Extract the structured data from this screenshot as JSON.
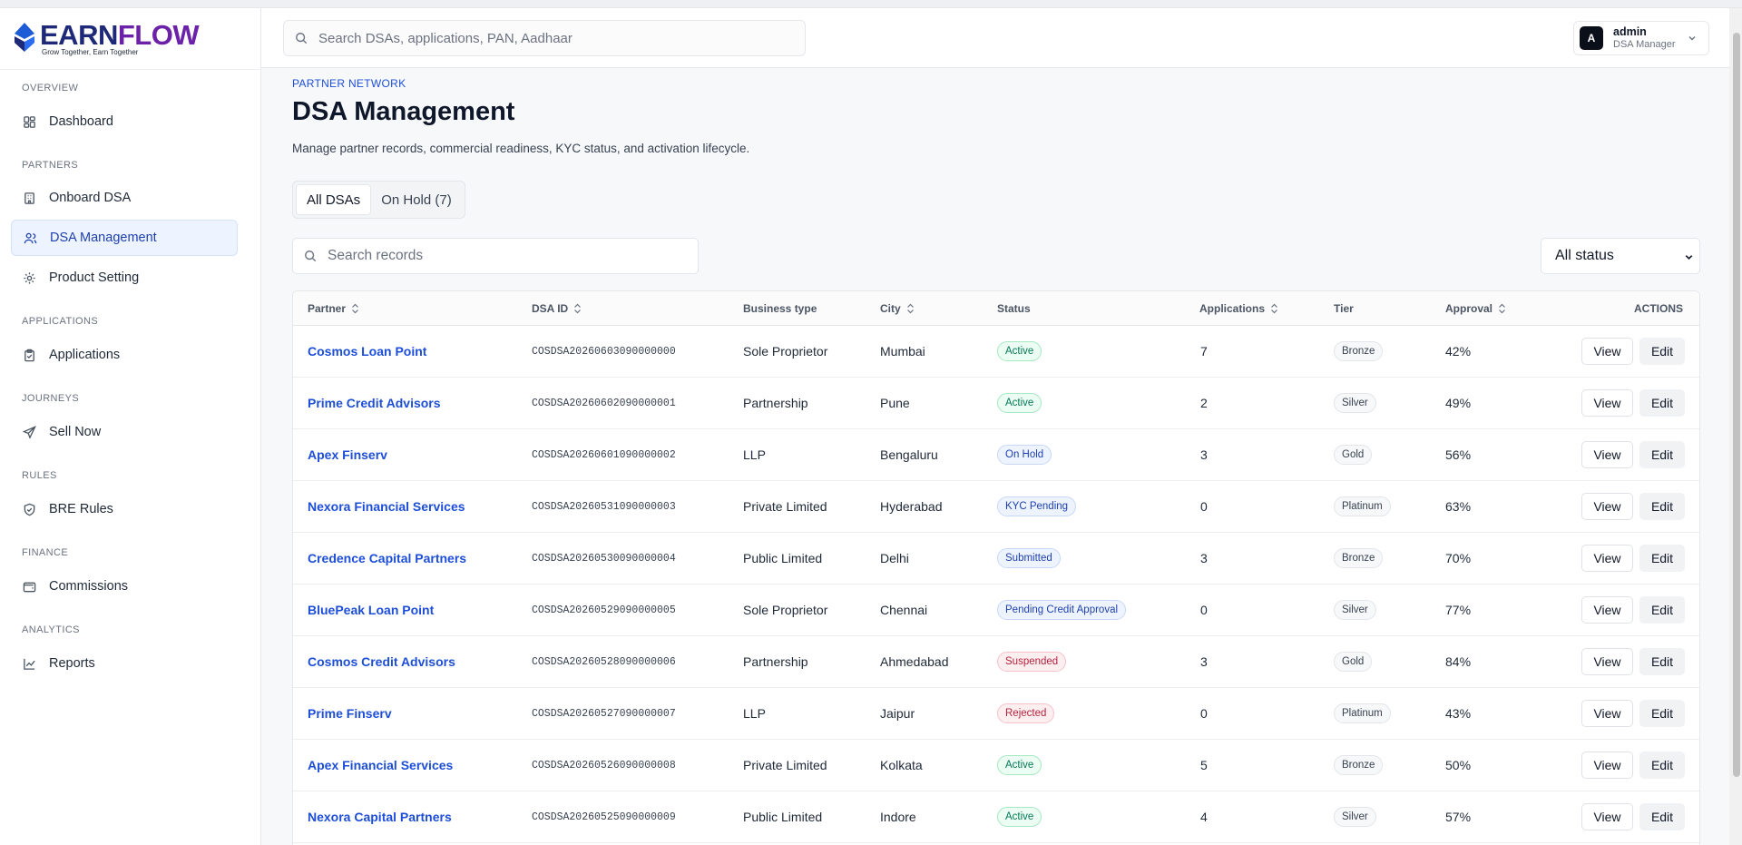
{
  "brand": {
    "name_part1": "EARN",
    "name_part2": "FLOW",
    "tagline": "Grow Together, Earn Together"
  },
  "search": {
    "placeholder": "Search DSAs, applications, PAN, Aadhaar"
  },
  "user": {
    "initial": "A",
    "name": "admin",
    "role": "DSA Manager"
  },
  "sidebar": {
    "sections": [
      {
        "label": "OVERVIEW"
      },
      {
        "label": "PARTNERS"
      },
      {
        "label": "APPLICATIONS"
      },
      {
        "label": "JOURNEYS"
      },
      {
        "label": "RULES"
      },
      {
        "label": "FINANCE"
      },
      {
        "label": "ANALYTICS"
      }
    ],
    "items": [
      {
        "label": "Dashboard",
        "icon": "grid-icon"
      },
      {
        "label": "Onboard DSA",
        "icon": "building-icon"
      },
      {
        "label": "DSA Management",
        "icon": "users-icon",
        "active": true
      },
      {
        "label": "Product Setting",
        "icon": "gear-icon"
      },
      {
        "label": "Applications",
        "icon": "clipboard-icon"
      },
      {
        "label": "Sell Now",
        "icon": "send-icon"
      },
      {
        "label": "BRE Rules",
        "icon": "shield-icon"
      },
      {
        "label": "Commissions",
        "icon": "wallet-icon"
      },
      {
        "label": "Reports",
        "icon": "chart-line-icon"
      }
    ]
  },
  "page": {
    "eyebrow": "PARTNER NETWORK",
    "title": "DSA Management",
    "description": "Manage partner records, commercial readiness, KYC status, and activation lifecycle."
  },
  "tabs": [
    {
      "label": "All DSAs",
      "active": true
    },
    {
      "label": "On Hold (7)",
      "active": false
    }
  ],
  "records_search": {
    "placeholder": "Search records"
  },
  "status_filter": {
    "selected": "All status"
  },
  "table": {
    "columns": [
      "Partner",
      "DSA ID",
      "Business type",
      "City",
      "Status",
      "Applications",
      "Tier",
      "Approval",
      "ACTIONS"
    ],
    "view_label": "View",
    "edit_label": "Edit",
    "rows": [
      {
        "partner": "Cosmos Loan Point",
        "dsa_id": "COSDSA20260603090000000",
        "business_type": "Sole Proprietor",
        "city": "Mumbai",
        "status": "Active",
        "applications": "7",
        "tier": "Bronze",
        "approval": "42%"
      },
      {
        "partner": "Prime Credit Advisors",
        "dsa_id": "COSDSA20260602090000001",
        "business_type": "Partnership",
        "city": "Pune",
        "status": "Active",
        "applications": "2",
        "tier": "Silver",
        "approval": "49%"
      },
      {
        "partner": "Apex Finserv",
        "dsa_id": "COSDSA20260601090000002",
        "business_type": "LLP",
        "city": "Bengaluru",
        "status": "On Hold",
        "applications": "3",
        "tier": "Gold",
        "approval": "56%"
      },
      {
        "partner": "Nexora Financial Services",
        "dsa_id": "COSDSA20260531090000003",
        "business_type": "Private Limited",
        "city": "Hyderabad",
        "status": "KYC Pending",
        "applications": "0",
        "tier": "Platinum",
        "approval": "63%"
      },
      {
        "partner": "Credence Capital Partners",
        "dsa_id": "COSDSA20260530090000004",
        "business_type": "Public Limited",
        "city": "Delhi",
        "status": "Submitted",
        "applications": "3",
        "tier": "Bronze",
        "approval": "70%"
      },
      {
        "partner": "BluePeak Loan Point",
        "dsa_id": "COSDSA20260529090000005",
        "business_type": "Sole Proprietor",
        "city": "Chennai",
        "status": "Pending Credit Approval",
        "applications": "0",
        "tier": "Silver",
        "approval": "77%"
      },
      {
        "partner": "Cosmos Credit Advisors",
        "dsa_id": "COSDSA20260528090000006",
        "business_type": "Partnership",
        "city": "Ahmedabad",
        "status": "Suspended",
        "applications": "3",
        "tier": "Gold",
        "approval": "84%"
      },
      {
        "partner": "Prime Finserv",
        "dsa_id": "COSDSA20260527090000007",
        "business_type": "LLP",
        "city": "Jaipur",
        "status": "Rejected",
        "applications": "0",
        "tier": "Platinum",
        "approval": "43%"
      },
      {
        "partner": "Apex Financial Services",
        "dsa_id": "COSDSA20260526090000008",
        "business_type": "Private Limited",
        "city": "Kolkata",
        "status": "Active",
        "applications": "5",
        "tier": "Bronze",
        "approval": "50%"
      },
      {
        "partner": "Nexora Capital Partners",
        "dsa_id": "COSDSA20260525090000009",
        "business_type": "Public Limited",
        "city": "Indore",
        "status": "Active",
        "applications": "4",
        "tier": "Silver",
        "approval": "57%"
      }
    ]
  },
  "colors": {
    "accent": "#1d4ed8",
    "brand_navy": "#1e2a78",
    "brand_purple": "#6b21a8",
    "active_green": "#047857",
    "danger_red": "#b4233f"
  }
}
